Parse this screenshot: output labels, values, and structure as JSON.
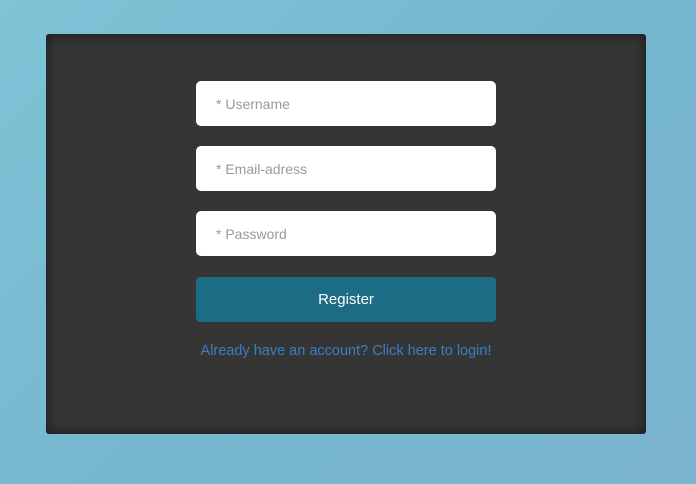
{
  "form": {
    "username_placeholder": "* Username",
    "email_placeholder": "* Email-adress",
    "password_placeholder": "* Password",
    "register_label": "Register",
    "login_link_text": "Already have an account? Click here to login!"
  },
  "colors": {
    "background": "#7ec3d6",
    "card": "#353535",
    "button": "#1b6c84",
    "link": "#3a7fc4"
  }
}
